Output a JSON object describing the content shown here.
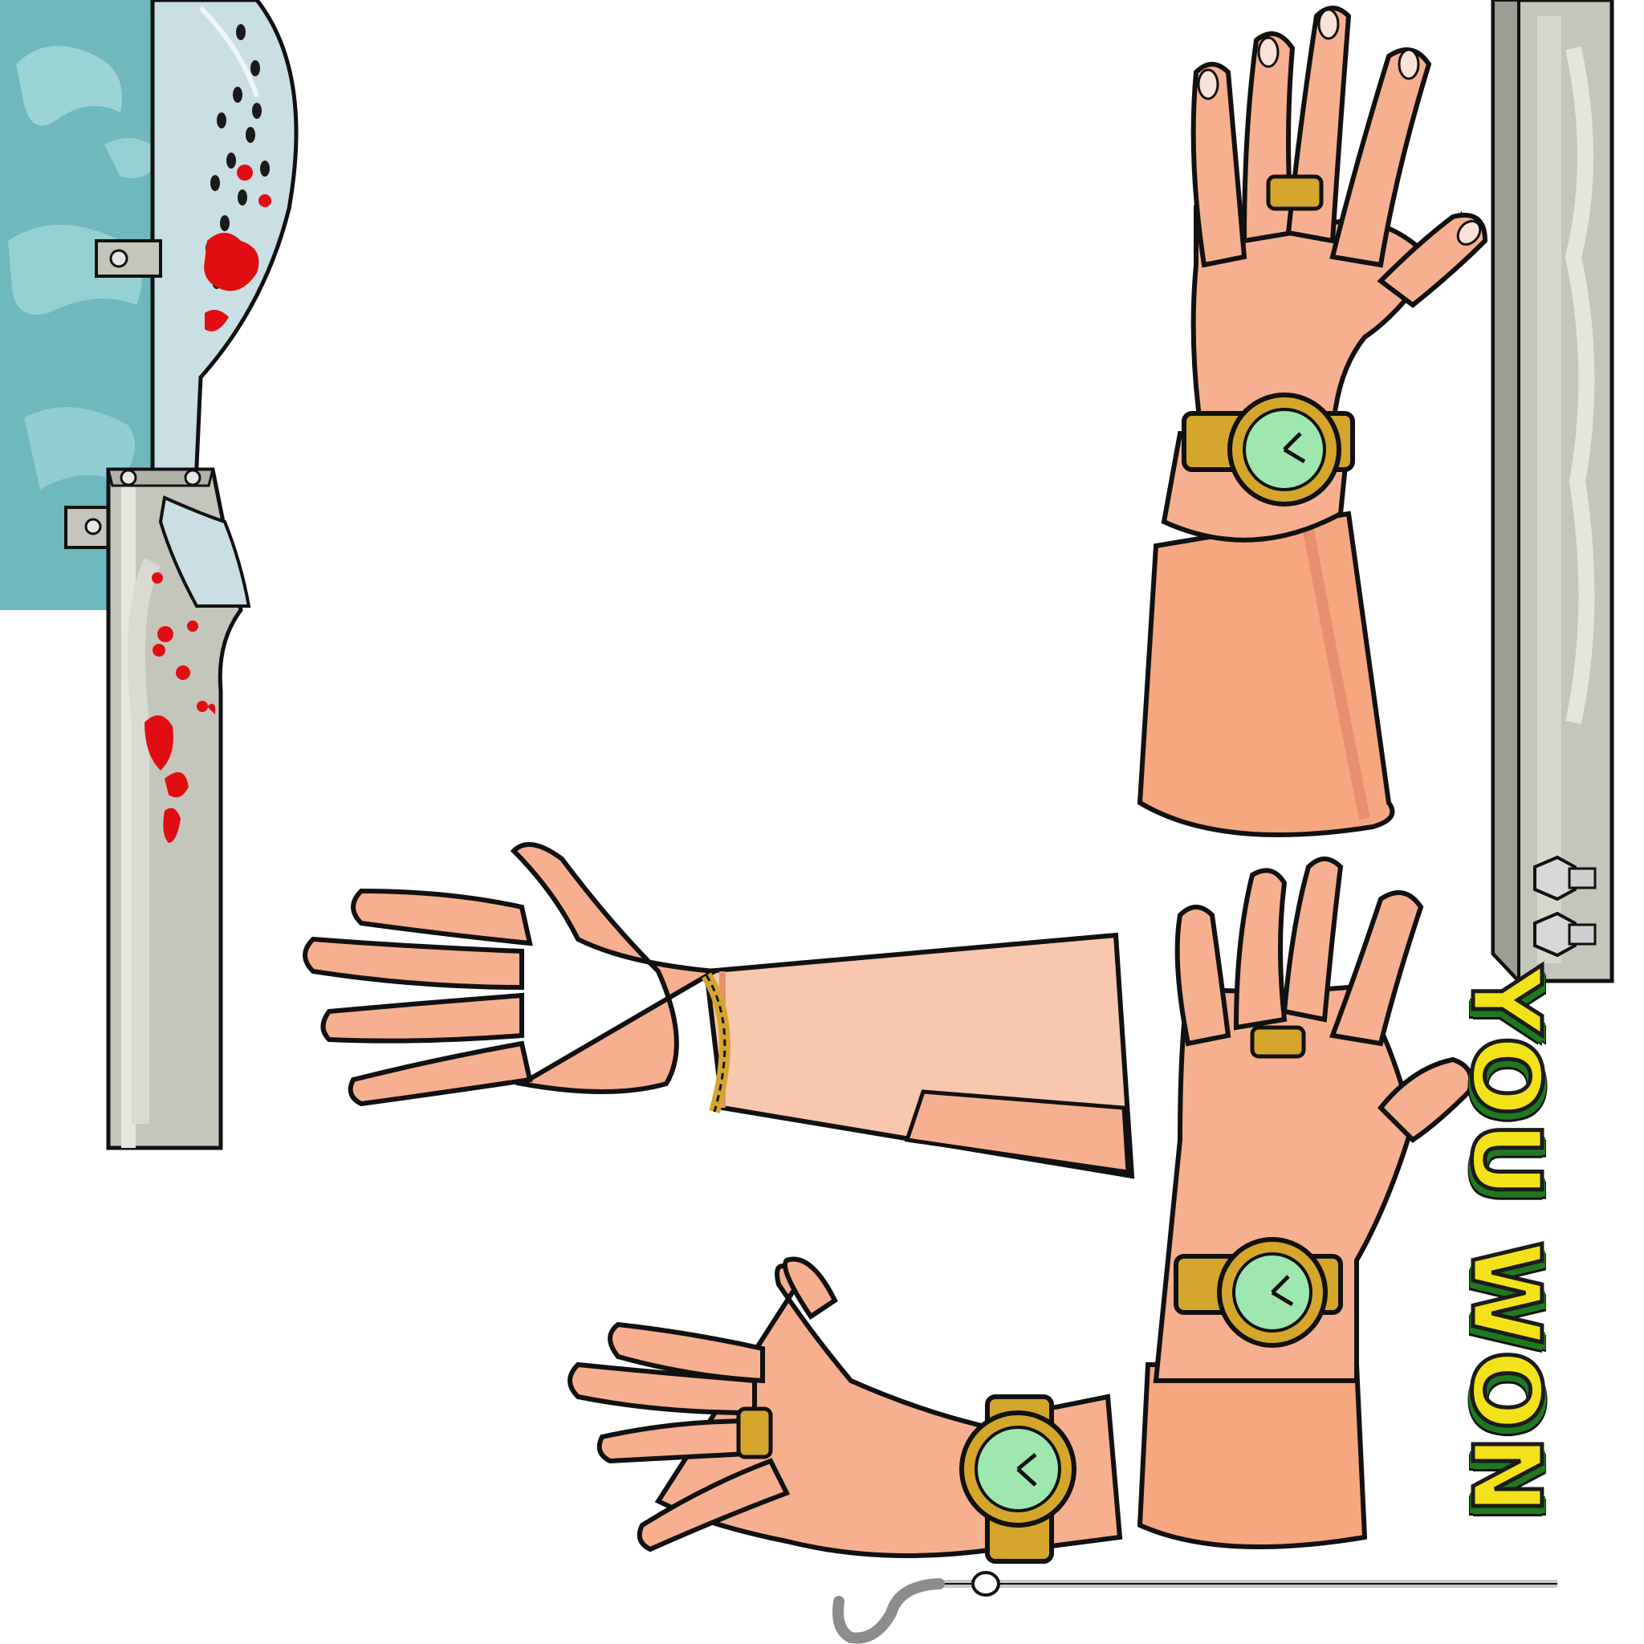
{
  "banner": {
    "text": "YOU WON"
  },
  "sprites": [
    "cleaver-machine",
    "steel-post",
    "raised-hand-watch",
    "reaching-arm-bracelet",
    "raised-hand-watch-lower",
    "side-hand-watch",
    "hook-rod"
  ],
  "colors": {
    "skin": "#f7b08f",
    "skin_light": "#f9c7ad",
    "skin_shadow": "#e8906e",
    "gold": "#d4a62c",
    "watch_face": "#9ee8b0",
    "blood": "#e10d12",
    "machine_teal": "#6fb8bd",
    "steel": "#c4c6bb",
    "banner_yellow": "#f3e21a",
    "banner_green": "#1f7a1f"
  }
}
